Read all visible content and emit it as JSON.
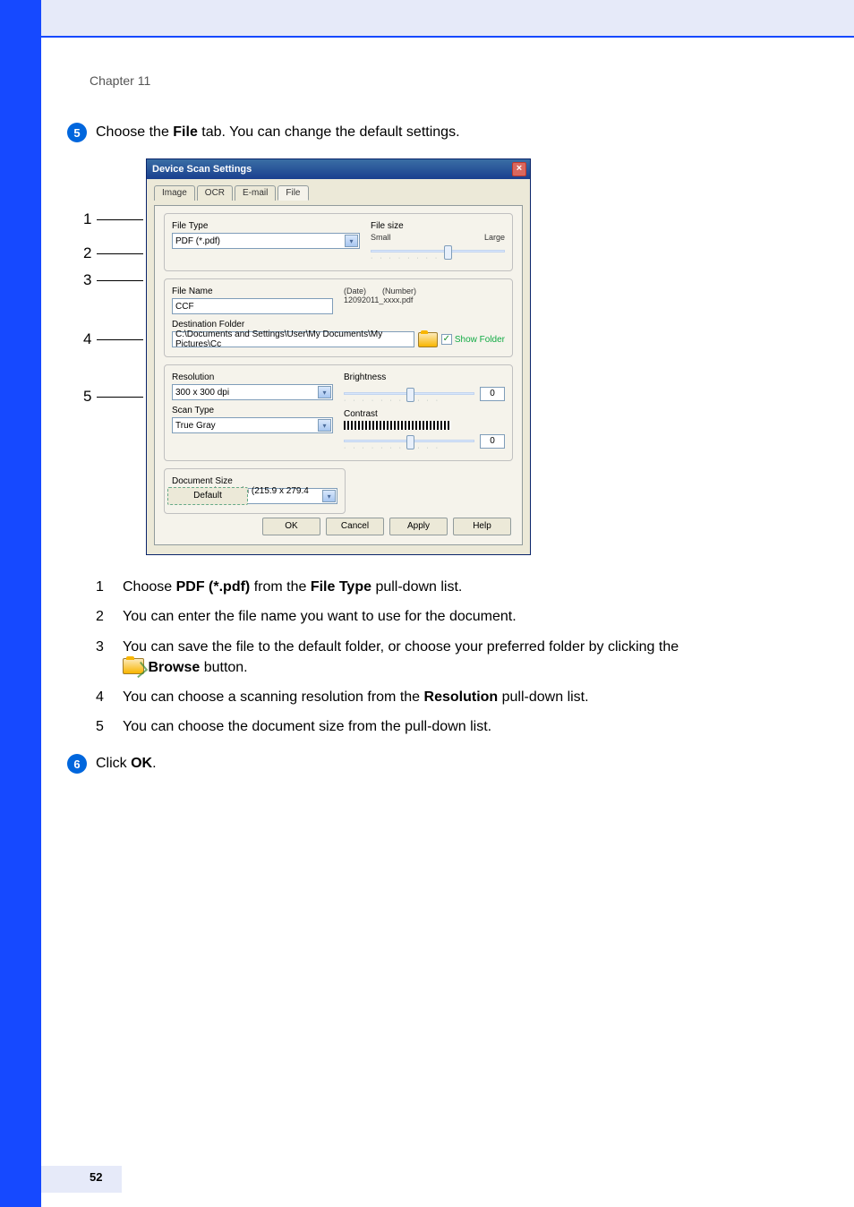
{
  "chapter": "Chapter 11",
  "page_number": "52",
  "step5": {
    "badge": "5",
    "pre": "Choose the ",
    "bold": "File",
    "post": " tab. You can change the default settings."
  },
  "step6": {
    "badge": "6",
    "pre": "Click ",
    "bold": "OK",
    "post": "."
  },
  "callouts": [
    "1",
    "2",
    "3",
    "4",
    "5"
  ],
  "dialog": {
    "title": "Device Scan Settings",
    "tabs": [
      "Image",
      "OCR",
      "E-mail",
      "File"
    ],
    "active_tab": "File",
    "file_type": {
      "label": "File Type",
      "value": "PDF (*.pdf)"
    },
    "file_size": {
      "label": "File size",
      "small": "Small",
      "large": "Large"
    },
    "file_name": {
      "label": "File Name",
      "value": "CCF",
      "date_lbl": "(Date)",
      "num_lbl": "(Number)",
      "pattern": "12092011_xxxx.pdf"
    },
    "dest": {
      "label": "Destination Folder",
      "path": "C:\\Documents and Settings\\User\\My Documents\\My Pictures\\Cc",
      "show_folder": "Show Folder"
    },
    "resolution": {
      "label": "Resolution",
      "value": "300 x 300 dpi"
    },
    "scan_type": {
      "label": "Scan Type",
      "value": "True Gray"
    },
    "doc_size": {
      "label": "Document Size",
      "value": "Letter 8 1/2 x 11 in (215.9 x 279.4 mm)"
    },
    "brightness": {
      "label": "Brightness",
      "value": "0"
    },
    "contrast": {
      "label": "Contrast",
      "value": "0"
    },
    "default_btn": "Default",
    "buttons": {
      "ok": "OK",
      "cancel": "Cancel",
      "apply": "Apply",
      "help": "Help"
    }
  },
  "sublist": {
    "i1": {
      "n": "1",
      "a": "Choose ",
      "b": "PDF (*.pdf)",
      "c": " from the ",
      "d": "File Type",
      "e": " pull-down list."
    },
    "i2": {
      "n": "2",
      "t": "You can enter the file name you want to use for the document."
    },
    "i3": {
      "n": "3",
      "a": "You can save the file to the default folder, or choose your preferred folder by clicking the ",
      "b": "Browse",
      "c": " button."
    },
    "i4": {
      "n": "4",
      "a": "You can choose a scanning resolution from the ",
      "b": "Resolution",
      "c": " pull-down list."
    },
    "i5": {
      "n": "5",
      "t": "You can choose the document size from the pull-down list."
    }
  }
}
